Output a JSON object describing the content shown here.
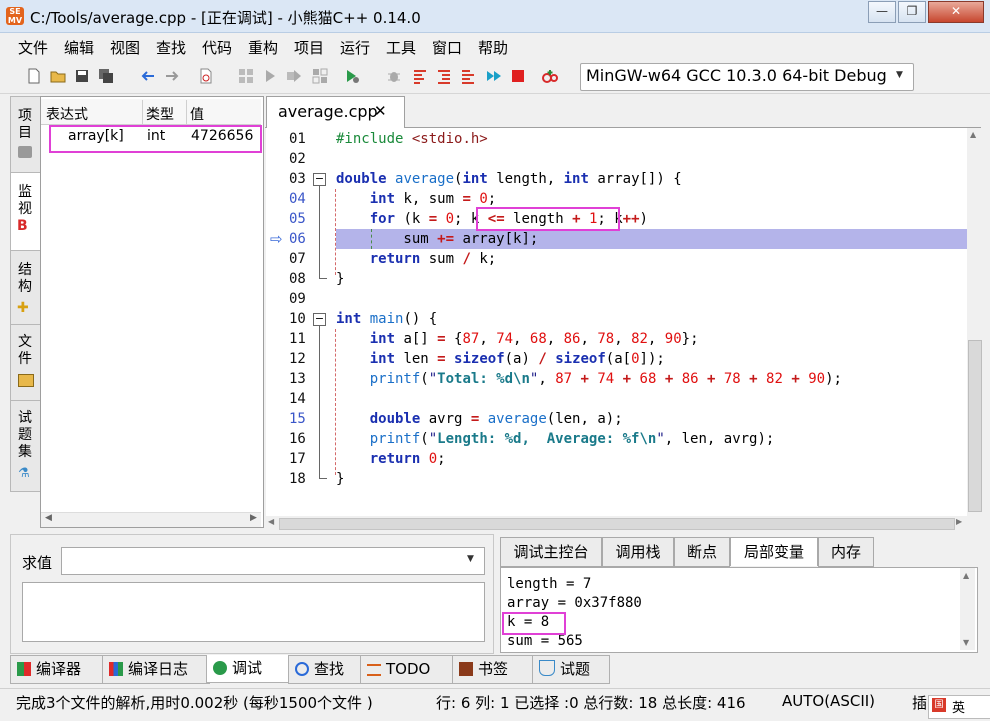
{
  "window": {
    "title": "C:/Tools/average.cpp - [正在调试] - 小熊猫C++ 0.14.0",
    "app_icon_text": "SE MV"
  },
  "menu": [
    "文件",
    "编辑",
    "视图",
    "查找",
    "代码",
    "重构",
    "项目",
    "运行",
    "工具",
    "窗口",
    "帮助"
  ],
  "toolbar": {
    "compiler": "MinGW-w64 GCC 10.3.0 64-bit Debug"
  },
  "left_tabs": [
    "项目",
    "监视",
    "结构",
    "文件",
    "试题集"
  ],
  "watch": {
    "headers": [
      "表达式",
      "类型",
      "值"
    ],
    "rows": [
      {
        "expr": "array[k]",
        "type": "int",
        "value": "4726656"
      }
    ]
  },
  "editor": {
    "tab_label": "average.cpp",
    "tab_close": "✕",
    "current_line": 6,
    "line_numbers": [
      "01",
      "02",
      "03",
      "04",
      "05",
      "06",
      "07",
      "08",
      "09",
      "10",
      "11",
      "12",
      "13",
      "14",
      "15",
      "16",
      "17",
      "18"
    ]
  },
  "eval": {
    "label": "求值"
  },
  "debug_tabs": [
    "调试主控台",
    "调用栈",
    "断点",
    "局部变量",
    "内存"
  ],
  "locals": [
    "length = 7",
    "array = 0x37f880",
    "k = 8",
    "sum = 565"
  ],
  "bottom_tabs": [
    "编译器",
    "编译日志",
    "调试",
    "查找",
    "TODO",
    "书签",
    "试题"
  ],
  "status": {
    "message": "完成3个文件的解析,用时0.002秒 (每秒1500个文件 )",
    "position": "行: 6 列: 1 已选择 :0 总行数: 18 总长度: 416",
    "encoding": "AUTO(ASCII)",
    "insert": "插",
    "ime": "英"
  },
  "colors": {
    "highlight_box": "#e040d6",
    "current_line_bg": "#b4b4ea",
    "keyword": "#1a2fb0",
    "number": "#e01010"
  }
}
